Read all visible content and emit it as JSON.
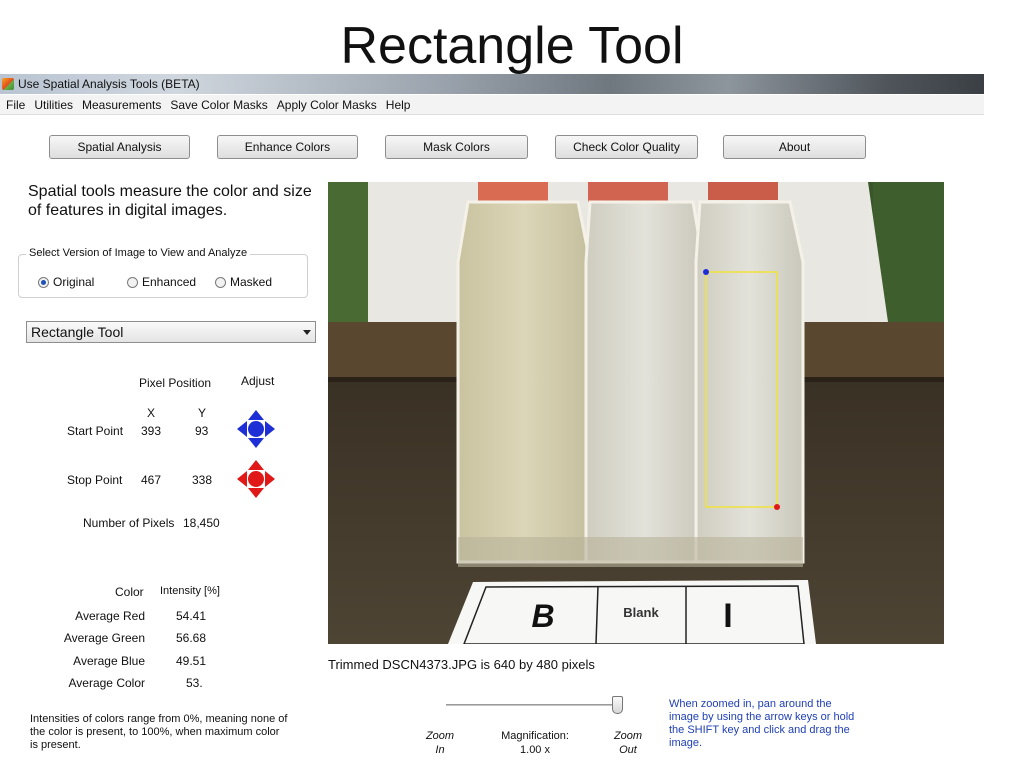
{
  "slide": {
    "title": "Rectangle Tool"
  },
  "window": {
    "title": "Use Spatial Analysis Tools (BETA)"
  },
  "menu": [
    "File",
    "Utilities",
    "Measurements",
    "Save Color Masks",
    "Apply Color Masks",
    "Help"
  ],
  "toolbar": {
    "spatial": "Spatial Analysis",
    "enhance": "Enhance Colors",
    "mask": "Mask Colors",
    "quality": "Check Color Quality",
    "about": "About"
  },
  "description": "Spatial tools measure the color and size of features in digital images.",
  "version": {
    "group_title": "Select Version of Image to View and Analyze",
    "options": [
      "Original",
      "Enhanced",
      "Masked"
    ],
    "selected": "Original"
  },
  "tool": {
    "selected": "Rectangle Tool"
  },
  "position": {
    "pixel_position": "Pixel Position",
    "adjust": "Adjust",
    "x_header": "X",
    "y_header": "Y",
    "start_label": "Start Point",
    "start_x": "393",
    "start_y": "93",
    "stop_label": "Stop Point",
    "stop_x": "467",
    "stop_y": "338",
    "pixels_label": "Number of Pixels",
    "pixels_value": "18,450"
  },
  "intensity": {
    "color_header": "Color",
    "intensity_header": "Intensity [%]",
    "rows": [
      {
        "label": "Average Red",
        "value": "54.41"
      },
      {
        "label": "Average Green",
        "value": "56.68"
      },
      {
        "label": "Average Blue",
        "value": "49.51"
      },
      {
        "label": "Average Color",
        "value": "53."
      }
    ]
  },
  "footnote": "Intensities of colors range from 0%, meaning none of the color is present, to 100%, when maximum color is present.",
  "image": {
    "caption": "Trimmed DSCN4373.JPG is 640 by 480 pixels",
    "card_labels": [
      "B",
      "Blank",
      "I"
    ]
  },
  "zoom": {
    "zoom_in_1": "Zoom",
    "zoom_in_2": "In",
    "mag_label": "Magnification:",
    "mag_value": "1.00 x",
    "zoom_out_1": "Zoom",
    "zoom_out_2": "Out"
  },
  "help": "When zoomed in, pan around the image by using the arrow keys or hold the SHIFT key and click and drag the image.",
  "colors": {
    "start_pad": "#1f2fd6",
    "stop_pad": "#e01818",
    "selection": "#f2e23a",
    "help_text": "#1f3fb3"
  },
  "icons": {
    "start_pad": "blue-direction-pad-icon",
    "stop_pad": "red-direction-pad-icon",
    "app": "app-icon"
  }
}
